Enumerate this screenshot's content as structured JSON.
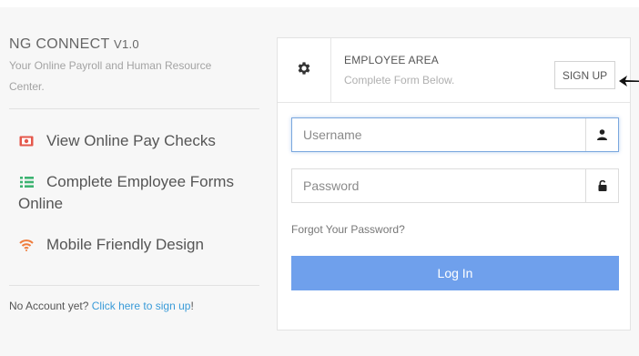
{
  "app": {
    "title": "NG CONNECT ",
    "version": "V1.0",
    "subtitle": "Your Online Payroll and Human Resource Center."
  },
  "features": [
    {
      "label": "View Online Pay Checks",
      "icon": "money-icon",
      "color": "#e4574b"
    },
    {
      "label": "Complete Employee Forms Online",
      "icon": "list-icon",
      "color": "#3cb371"
    },
    {
      "label": "Mobile Friendly Design",
      "icon": "wifi-icon",
      "color": "#ef7c3c"
    }
  ],
  "footer": {
    "no_account": "No Account yet? ",
    "signup_link": "Click here to sign up",
    "excl": "!"
  },
  "panel": {
    "title": "EMPLOYEE AREA",
    "subtitle": "Complete Form Below.",
    "signup_label": "SIGN UP",
    "username_placeholder": "Username",
    "password_placeholder": "Password",
    "forgot": "Forgot Your Password?",
    "login_label": "Log In"
  },
  "colors": {
    "login_button": "#6fa0ec",
    "link": "#3a9bd8"
  }
}
